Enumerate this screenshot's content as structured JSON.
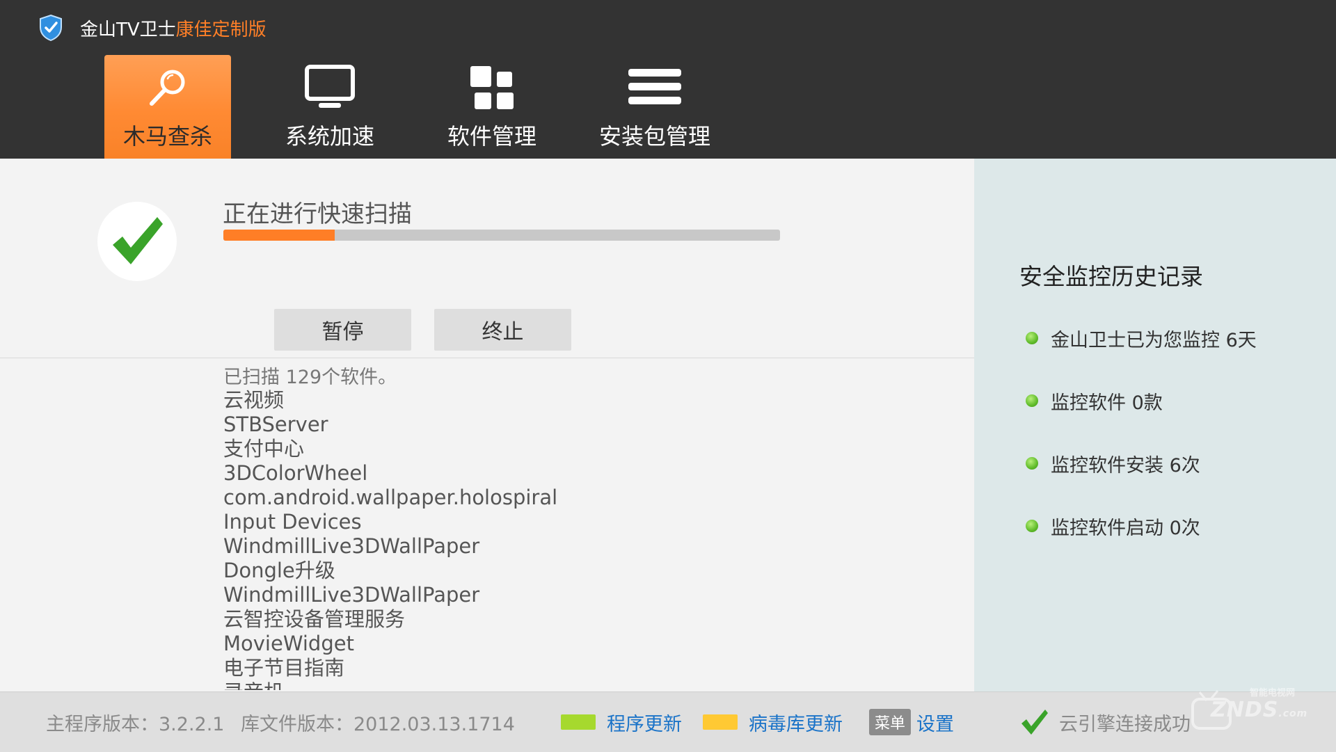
{
  "header": {
    "app_title": "金山TV卫士",
    "app_edition": "康佳定制版",
    "tabs": [
      {
        "label": "木马查杀",
        "icon": "search-icon",
        "active": true
      },
      {
        "label": "系统加速",
        "icon": "monitor-icon",
        "active": false
      },
      {
        "label": "软件管理",
        "icon": "grid-icon",
        "active": false
      },
      {
        "label": "安装包管理",
        "icon": "menu-icon",
        "active": false
      }
    ]
  },
  "scan": {
    "title": "正在进行快速扫描",
    "progress_percent": 20,
    "pause_label": "暂停",
    "stop_label": "终止",
    "scanned_count": "已扫描 129个软件。",
    "apps": [
      "云视频",
      "STBServer",
      "支付中心",
      "3DColorWheel",
      "com.android.wallpaper.holospiral",
      "Input Devices",
      "WindmillLive3DWallPaper",
      "Dongle升级",
      "WindmillLive3DWallPaper",
      "云智控设备管理服务",
      "MovieWidget",
      "电子节目指南",
      "录音机"
    ]
  },
  "history": {
    "title": "安全监控历史记录",
    "items": [
      "金山卫士已为您监控 6天",
      "监控软件 0款",
      "监控软件安装 6次",
      "监控软件启动 0次"
    ]
  },
  "footer": {
    "main_version": "主程序版本：3.2.2.1",
    "lib_version": "库文件版本：2012.03.13.1714",
    "program_update": "程序更新",
    "virus_update": "病毒库更新",
    "menu_key": "菜单",
    "settings": "设置",
    "cloud_status": "云引擎连接成功",
    "program_update_color": "#a6d92e",
    "virus_update_color": "#ffc933"
  },
  "watermark": {
    "text": "ZNDS",
    "suffix": ".com",
    "sub": "智能电视网"
  },
  "colors": {
    "accent": "#ff7e26",
    "header_bg": "#333333",
    "side_bg": "#dde8e9",
    "check_green": "#3aa32a"
  }
}
